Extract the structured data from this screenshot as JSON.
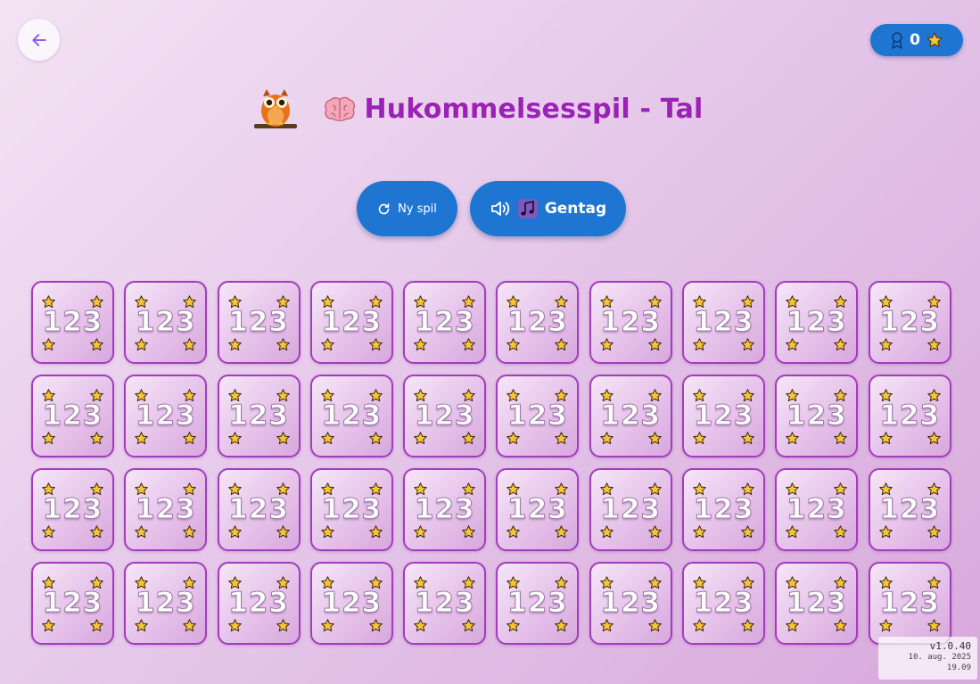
{
  "header": {
    "back_icon": "arrow-left-icon",
    "score": {
      "icon": "award-icon",
      "value": "0",
      "star_icon": "star-icon"
    }
  },
  "title": {
    "mascot_icon": "owl-icon",
    "brain_icon": "brain-icon",
    "text": "Hukommelsesspil - Tal"
  },
  "buttons": {
    "new_game": {
      "icon": "refresh-icon",
      "label": "Ny spil"
    },
    "repeat": {
      "icon": "speaker-icon",
      "music_icon": "music-notes-icon",
      "label": "Gentag"
    }
  },
  "board": {
    "rows": 4,
    "columns": 10,
    "card_back_label": "123",
    "card_back_icon": "star-icon"
  },
  "colors": {
    "accent_blue": "#1f76d2",
    "title_purple": "#9a22b5",
    "card_border": "#a43cbf",
    "star_gold": "#f6c33a"
  },
  "version": {
    "number": "v1.0.40",
    "date": "10. aug. 2025",
    "time": "19.09"
  }
}
